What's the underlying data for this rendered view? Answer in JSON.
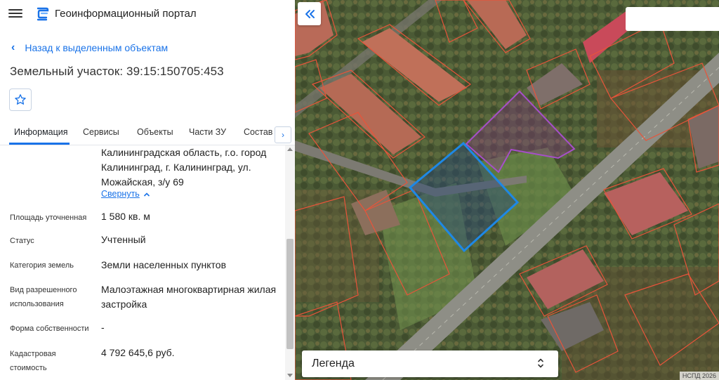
{
  "app": {
    "title": "Геоинформационный портал"
  },
  "nav": {
    "back_label": "Назад к выделенным объектам"
  },
  "parcel": {
    "title": "Земельный участок: 39:15:150705:453"
  },
  "tabs": [
    {
      "label": "Информация",
      "active": true
    },
    {
      "label": "Сервисы"
    },
    {
      "label": "Объекты"
    },
    {
      "label": "Части ЗУ"
    },
    {
      "label": "Состав"
    }
  ],
  "info": {
    "address_lines": [
      "Калининградская область, г.о. город",
      "Калининград, г. Калининград, ул.",
      "Можайская, з/у 69"
    ],
    "collapse_label": "Свернуть",
    "rows": [
      {
        "label": "Площадь уточненная",
        "value": "1 580 кв. м"
      },
      {
        "label": "Статус",
        "value": "Учтенный"
      },
      {
        "label": "Категория земель",
        "value": "Земли населенных пунктов"
      },
      {
        "label": "Вид разрешенного использования",
        "value": "Малоэтажная многоквартирная жилая застройка"
      },
      {
        "label": "Форма собственности",
        "value": "-"
      },
      {
        "label": "Кадастровая стоимость",
        "value": "4 792 645,6 руб."
      }
    ]
  },
  "map": {
    "legend_label": "Легенда",
    "attribution": "НСПД 2026",
    "colors": {
      "selected_parcel": "#1e88e5",
      "highlight_parcel": "#a64fc9",
      "parcel_boundary": "#e8543a",
      "accent": "#1a73e8"
    }
  },
  "icons": {
    "menu": "hamburger-icon",
    "logo": "portal-logo-icon",
    "back": "chevron-left-icon",
    "favorite": "star-icon",
    "tabs_scroll": "chevron-right-icon",
    "collapse_panel": "double-chevron-left-icon",
    "legend_toggle": "chevron-up-down-icon"
  }
}
